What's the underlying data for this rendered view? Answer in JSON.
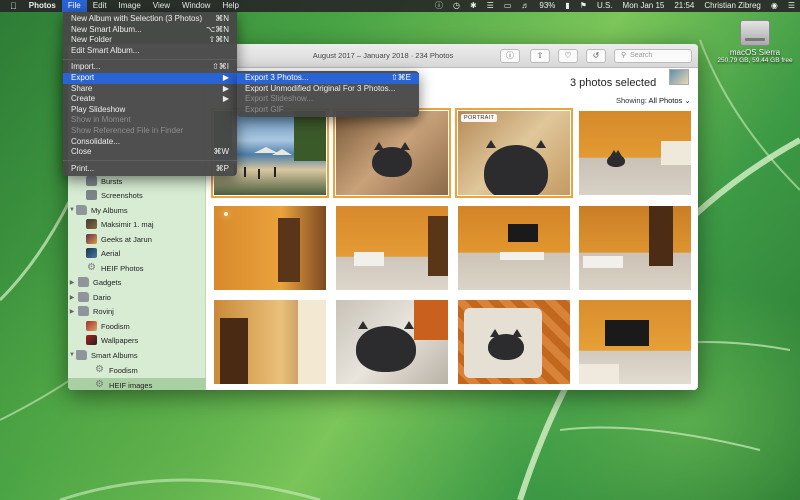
{
  "menubar": {
    "app_name": "Photos",
    "menus": [
      "File",
      "Edit",
      "Image",
      "View",
      "Window",
      "Help"
    ],
    "status": {
      "battery": "93%",
      "input_source": "U.S.",
      "date": "Mon Jan 15",
      "time": "21:54",
      "user": "Christian Zibreg"
    }
  },
  "desktop": {
    "drive_name": "macOS Sierra",
    "drive_free": "250.79 GB, 59.44 GB free"
  },
  "window": {
    "title": "August 2017 – January 2018 · 234 Photos",
    "search_placeholder": "Search",
    "selected_count": "3 photos selected",
    "showing_label": "Showing:",
    "showing_value": "All Photos ⌄",
    "portrait_badge": "PORTRAIT"
  },
  "sidebar": {
    "items": [
      {
        "label": "Bursts"
      },
      {
        "label": "Screenshots"
      },
      {
        "label": "My Albums"
      },
      {
        "label": "Maksimir 1. maj"
      },
      {
        "label": "Geeks at Jarun"
      },
      {
        "label": "Aerial"
      },
      {
        "label": "HEIF Photos"
      },
      {
        "label": "Gadgets"
      },
      {
        "label": "Dario"
      },
      {
        "label": "Rovinj"
      },
      {
        "label": "Foodism"
      },
      {
        "label": "Wallpapers"
      },
      {
        "label": "Smart Albums"
      },
      {
        "label": "Foodism"
      },
      {
        "label": "HEIF images"
      }
    ]
  },
  "file_menu": {
    "items": [
      {
        "label": "New Album with Selection (3 Photos)",
        "shortcut": "⌘N"
      },
      {
        "label": "New Smart Album...",
        "shortcut": "⌥⌘N"
      },
      {
        "label": "New Folder",
        "shortcut": "⇧⌘N"
      },
      {
        "label": "Edit Smart Album...",
        "shortcut": ""
      },
      {
        "label": "Import...",
        "shortcut": "⇧⌘I"
      },
      {
        "label": "Export",
        "shortcut": "▶"
      },
      {
        "label": "Share",
        "shortcut": "▶"
      },
      {
        "label": "Create",
        "shortcut": "▶"
      },
      {
        "label": "Play Slideshow",
        "shortcut": ""
      },
      {
        "label": "Show in Moment",
        "shortcut": ""
      },
      {
        "label": "Show Referenced File in Finder",
        "shortcut": ""
      },
      {
        "label": "Consolidate...",
        "shortcut": ""
      },
      {
        "label": "Close",
        "shortcut": "⌘W"
      },
      {
        "label": "Print...",
        "shortcut": "⌘P"
      }
    ]
  },
  "export_menu": {
    "items": [
      {
        "label": "Export 3 Photos...",
        "shortcut": "⇧⌘E"
      },
      {
        "label": "Export Unmodified Original For 3 Photos...",
        "shortcut": ""
      },
      {
        "label": "Export Slideshow...",
        "shortcut": ""
      },
      {
        "label": "Export GIF",
        "shortcut": ""
      }
    ]
  },
  "colors": {
    "accent": "#2a63d4",
    "selection_outline": "#f0a23a",
    "sidebar_bg": "#d7ecd3"
  }
}
